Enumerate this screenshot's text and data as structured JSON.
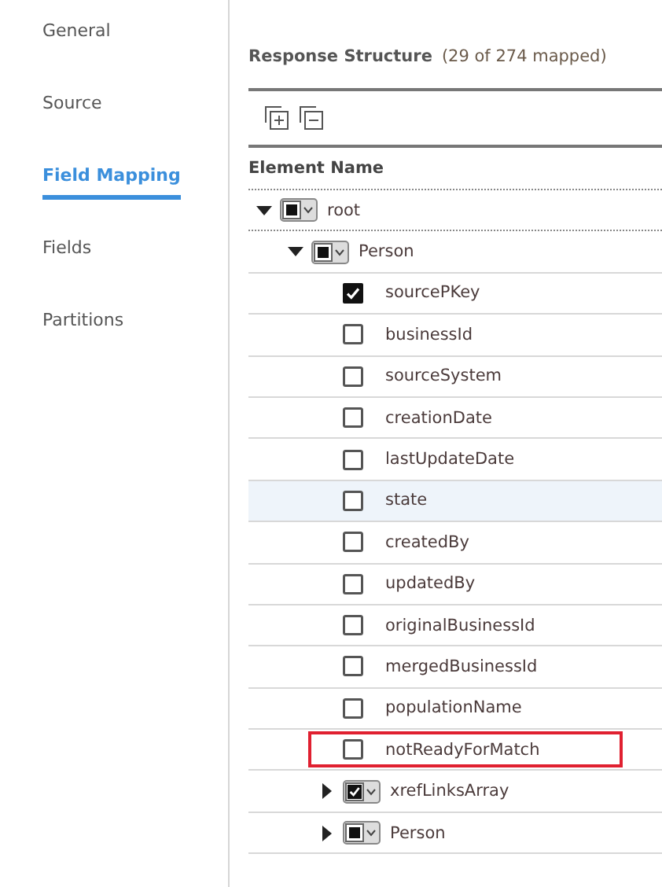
{
  "sidebar": {
    "items": [
      {
        "label": "General",
        "selected": false
      },
      {
        "label": "Source",
        "selected": false
      },
      {
        "label": "Field Mapping",
        "selected": true
      },
      {
        "label": "Fields",
        "selected": false
      },
      {
        "label": "Partitions",
        "selected": false
      }
    ]
  },
  "structure": {
    "title": "Response Structure",
    "count": "(29 of 274 mapped)",
    "column": "Element Name",
    "tree": [
      {
        "label": "root",
        "kind": "group",
        "expanded": true,
        "partial": true,
        "selected": false,
        "outlined": false,
        "children": [
          {
            "label": "Person",
            "kind": "group",
            "expanded": true,
            "partial": true,
            "selected": false,
            "outlined": false,
            "children": [
              {
                "label": "sourcePKey",
                "kind": "field",
                "checked": true,
                "selected": false,
                "outlined": false
              },
              {
                "label": "businessId",
                "kind": "field",
                "checked": false,
                "selected": false,
                "outlined": false
              },
              {
                "label": "sourceSystem",
                "kind": "field",
                "checked": false,
                "selected": false,
                "outlined": false
              },
              {
                "label": "creationDate",
                "kind": "field",
                "checked": false,
                "selected": false,
                "outlined": false
              },
              {
                "label": "lastUpdateDate",
                "kind": "field",
                "checked": false,
                "selected": false,
                "outlined": false
              },
              {
                "label": "state",
                "kind": "field",
                "checked": false,
                "selected": true,
                "outlined": false
              },
              {
                "label": "createdBy",
                "kind": "field",
                "checked": false,
                "selected": false,
                "outlined": false
              },
              {
                "label": "updatedBy",
                "kind": "field",
                "checked": false,
                "selected": false,
                "outlined": false
              },
              {
                "label": "originalBusinessId",
                "kind": "field",
                "checked": false,
                "selected": false,
                "outlined": false
              },
              {
                "label": "mergedBusinessId",
                "kind": "field",
                "checked": false,
                "selected": false,
                "outlined": false
              },
              {
                "label": "populationName",
                "kind": "field",
                "checked": false,
                "selected": false,
                "outlined": false
              },
              {
                "label": "notReadyForMatch",
                "kind": "field",
                "checked": false,
                "selected": false,
                "outlined": true
              },
              {
                "label": "xrefLinksArray",
                "kind": "group",
                "expanded": false,
                "checked": true,
                "selected": false,
                "outlined": false
              },
              {
                "label": "Person",
                "kind": "group",
                "expanded": false,
                "partial": true,
                "selected": false,
                "outlined": false
              }
            ]
          }
        ]
      }
    ]
  }
}
